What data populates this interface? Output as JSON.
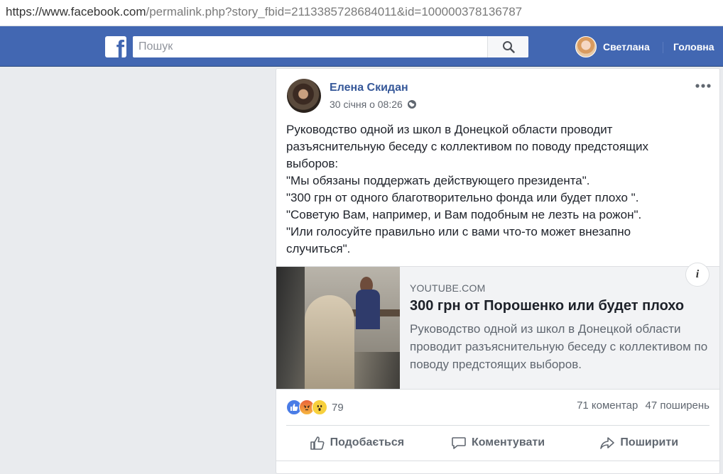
{
  "browser": {
    "url_host": "https://www.facebook.com",
    "url_path": "/permalink.php?story_fbid=2113385728684011&id=100000378136787"
  },
  "topbar": {
    "logo": "f",
    "search_placeholder": "Пошук",
    "search_icon": "search-icon",
    "profile_name": "Светлана",
    "home_label": "Головна",
    "color": "#4267b2"
  },
  "post": {
    "author": "Елена Скидан",
    "timestamp": "30 січня о 08:26",
    "privacy_icon": "globe-icon",
    "menu_icon": "more-icon",
    "text_lines": [
      "Руководство одной из школ в Донецкой области проводит разъяснительную беседу с коллективом по поводу предстоящих выборов:",
      "\"Мы обязаны поддержать действующего президента\".",
      "\"300 грн от одного благотворительно фонда или будет плохо \".",
      "\"Советую Вам, например, и Вам подобным не лезть на рожон\".",
      "\"Или голосуйте правильно или с вами что-то может внезапно случиться\"."
    ],
    "link": {
      "domain": "YOUTUBE.COM",
      "title": "300 грн от Порошенко или будет плохо",
      "description": "Руководство одной из школ в Донецкой области проводит разъяснительную беседу с коллективом по поводу предстоящих выборов.",
      "info_label": "i"
    },
    "reactions": {
      "types": [
        "like",
        "angry",
        "wow"
      ],
      "count": "79"
    },
    "comments": "71 коментар",
    "shares": "47 поширень",
    "actions": {
      "like": "Подобається",
      "comment": "Коментувати",
      "share": "Поширити"
    }
  }
}
